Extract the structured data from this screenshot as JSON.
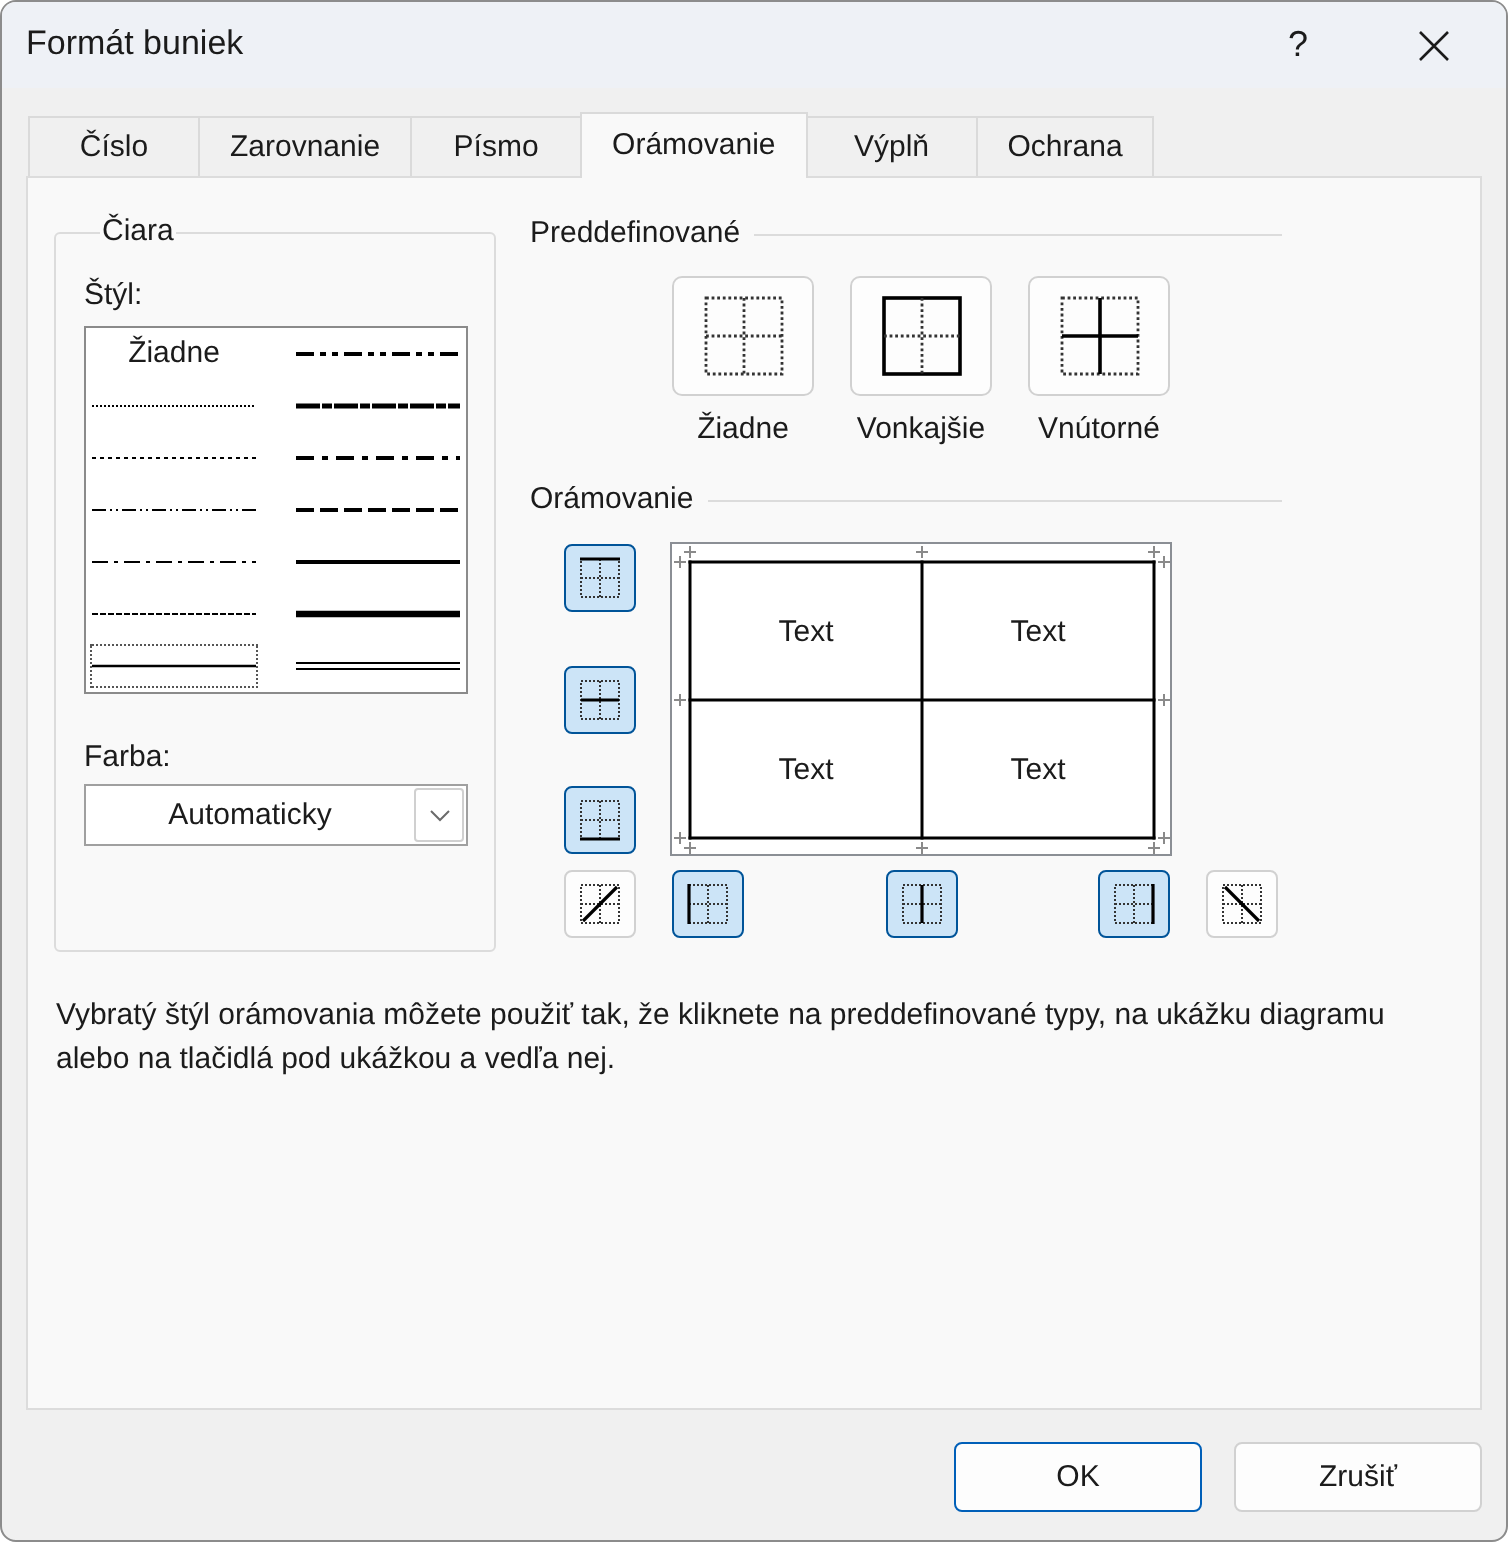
{
  "window": {
    "title": "Formát buniek",
    "help_label": "?"
  },
  "tabs": [
    {
      "label": "Číslo",
      "selected": false
    },
    {
      "label": "Zarovnanie",
      "selected": false
    },
    {
      "label": "Písmo",
      "selected": false
    },
    {
      "label": "Orámovanie",
      "selected": true
    },
    {
      "label": "Výplň",
      "selected": false
    },
    {
      "label": "Ochrana",
      "selected": false
    }
  ],
  "line": {
    "title": "Čiara",
    "style_label": "Štýl:",
    "styles": [
      {
        "kind": "none",
        "label": "Žiadne",
        "selected": false
      },
      {
        "kind": "hair",
        "selected": false
      },
      {
        "kind": "dotted",
        "selected": false
      },
      {
        "kind": "dashdotdot",
        "selected": false
      },
      {
        "kind": "dashdot",
        "selected": false
      },
      {
        "kind": "dashed",
        "selected": false
      },
      {
        "kind": "thin",
        "selected": true
      },
      {
        "kind": "mediumdashdotdot",
        "selected": false
      },
      {
        "kind": "slantdashdot",
        "selected": false
      },
      {
        "kind": "mediumdashdot",
        "selected": false
      },
      {
        "kind": "mediumdashed",
        "selected": false
      },
      {
        "kind": "medium",
        "selected": false
      },
      {
        "kind": "thick",
        "selected": false
      },
      {
        "kind": "double",
        "selected": false
      }
    ],
    "color_label": "Farba:",
    "color_value": "Automaticky"
  },
  "presets": {
    "title": "Preddefinované",
    "items": [
      {
        "kind": "none",
        "label": "Žiadne"
      },
      {
        "kind": "outline",
        "label": "Vonkajšie"
      },
      {
        "kind": "inside",
        "label": "Vnútorné"
      }
    ]
  },
  "border": {
    "title": "Orámovanie",
    "buttons": [
      {
        "kind": "top",
        "selected": true
      },
      {
        "kind": "middle",
        "selected": true
      },
      {
        "kind": "bottom",
        "selected": true
      },
      {
        "kind": "diagup",
        "selected": false
      },
      {
        "kind": "left",
        "selected": true
      },
      {
        "kind": "center",
        "selected": true
      },
      {
        "kind": "right",
        "selected": true
      },
      {
        "kind": "diagdown",
        "selected": false
      }
    ],
    "preview_cells": [
      "Text",
      "Text",
      "Text",
      "Text"
    ]
  },
  "help_text": "Vybratý štýl orámovania môžete použiť tak, že kliknete na preddefinované typy, na ukážku diagramu alebo na tlačidlá pod ukážkou a vedľa nej.",
  "buttons": [
    {
      "label": "OK",
      "default": true
    },
    {
      "label": "Zrušiť",
      "default": false
    }
  ]
}
